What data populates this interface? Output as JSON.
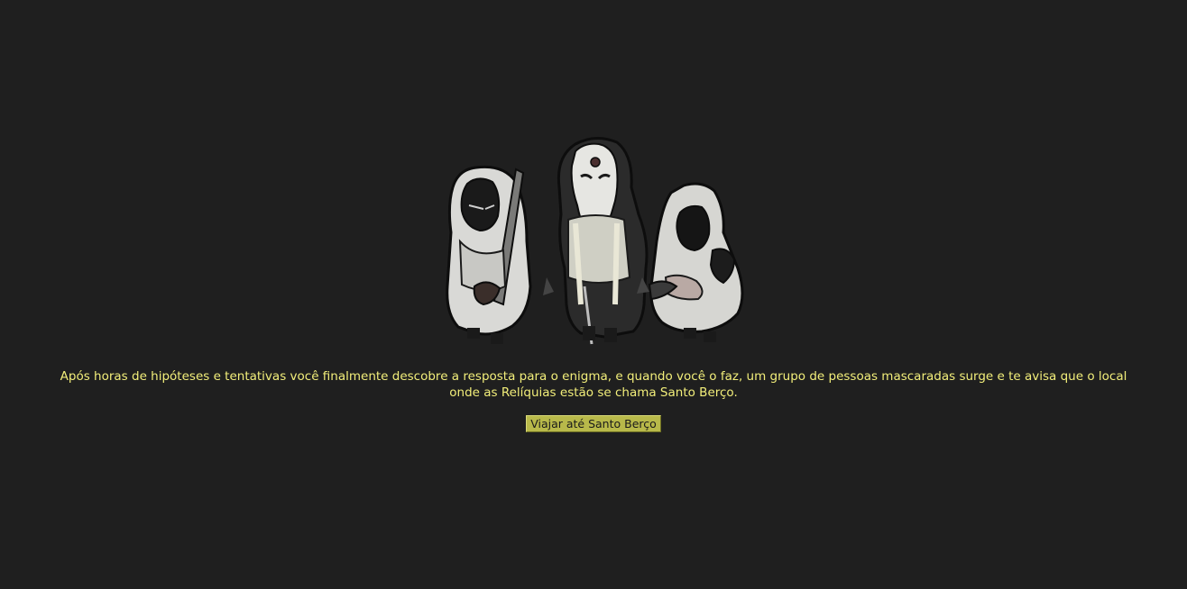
{
  "scene": {
    "illustration": "three-masked-hooded-figures",
    "narrative": "Após horas de hipóteses e tentativas você finalmente descobre a resposta para o enigma, e quando você o faz, um grupo de pessoas mascaradas surge e te avisa que o local onde as Relíquias estão se chama Santo Berço.",
    "action_label": "Viajar até Santo Berço"
  },
  "colors": {
    "background": "#1f1f1f",
    "text": "#f2ee7a",
    "button": "#b8b94a"
  }
}
